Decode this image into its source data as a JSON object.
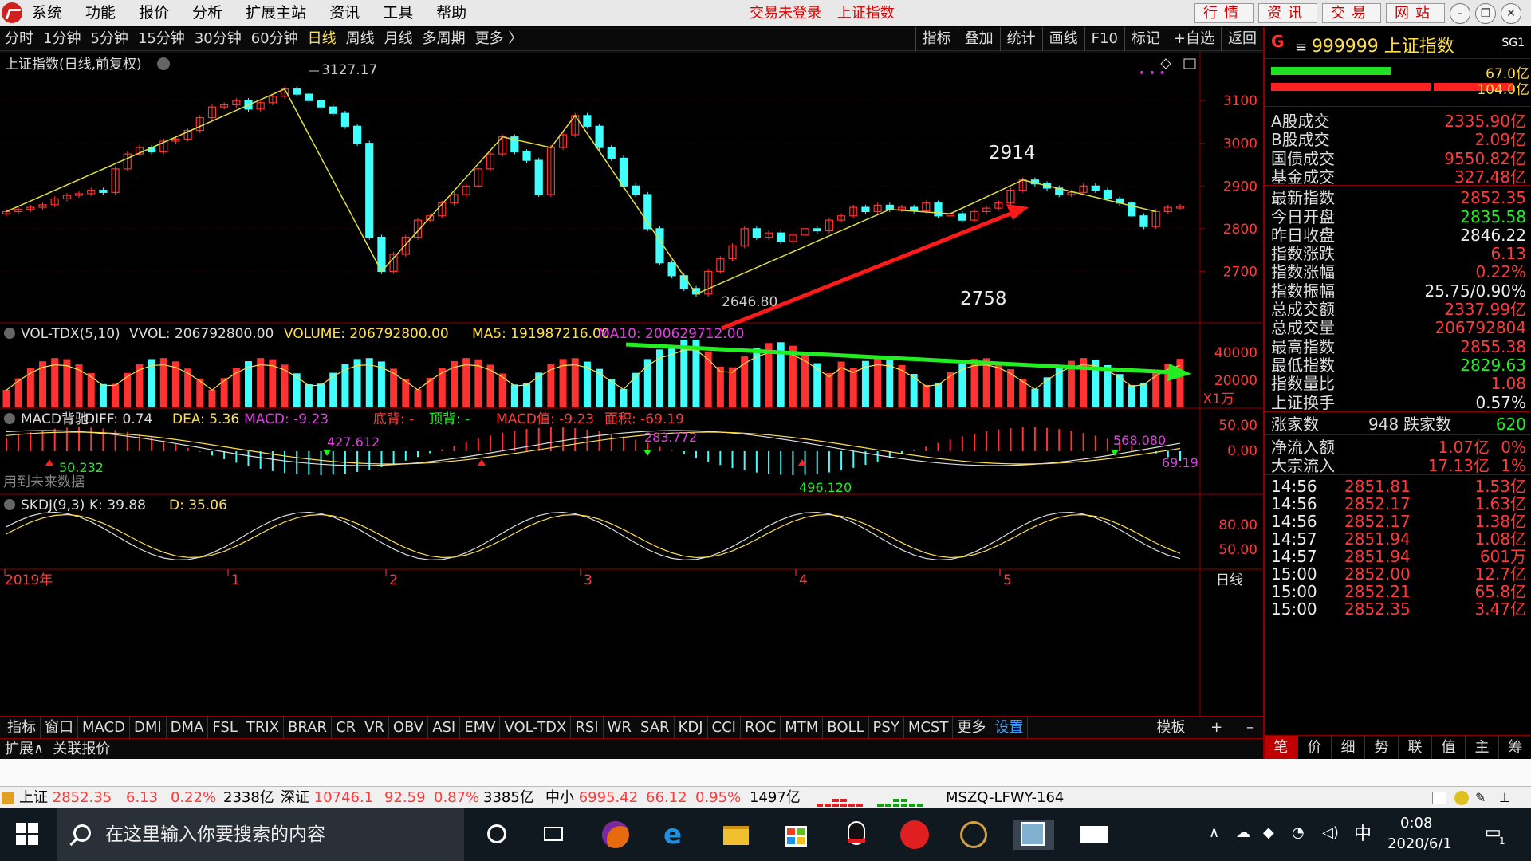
{
  "menubar": {
    "items": [
      "系统",
      "功能",
      "报价",
      "分析",
      "扩展主站",
      "资讯",
      "工具",
      "帮助"
    ],
    "status": "交易未登录",
    "title": "上证指数",
    "right_buttons": [
      "行情",
      "资讯",
      "交易",
      "网站"
    ]
  },
  "periodbar": {
    "items": [
      "分时",
      "1分钟",
      "5分钟",
      "15分钟",
      "30分钟",
      "60分钟",
      "日线",
      "周线",
      "月线",
      "多周期",
      "更多 〉"
    ],
    "active": "日线",
    "tools": [
      "指标",
      "叠加",
      "统计",
      "画线",
      "F10",
      "标记",
      "+自选",
      "返回"
    ]
  },
  "chart": {
    "title": "上证指数(日线,前复权)",
    "price_axis": [
      "3100",
      "3000",
      "2900",
      "2800",
      "2700"
    ],
    "annotations": {
      "high": "3127.17",
      "low": "2646.80",
      "label_2914": "2914",
      "label_2758": "2758"
    },
    "vol_header": {
      "name": "VOL-TDX(5,10)",
      "vvol": "VVOL: 206792800.00",
      "volume": "VOLUME: 206792800.00",
      "ma5": "MA5: 191987216.00",
      "ma10": "MA10: 200629712.00"
    },
    "vol_axis": [
      "40000",
      "20000",
      "X1万"
    ],
    "macd_header": {
      "name": "MACD背驰",
      "diff": "DIFF: 0.74",
      "dea": "DEA: 5.36",
      "macd": "MACD: -9.23",
      "bottom": "底背: -",
      "top": "顶背: -",
      "macd_val": "MACD值: -9.23",
      "area": "面积: -69.19"
    },
    "macd_axis": [
      "50.00",
      "0.00"
    ],
    "macd_labels": [
      "50.232",
      "427.612",
      "283.772",
      "496.120",
      "568.080",
      "69.19"
    ],
    "macd_note": "用到未来数据",
    "skdj_header": {
      "name": "SKDJ(9,3)",
      "k": "K: 39.88",
      "d": "D: 35.06"
    },
    "skdj_axis": [
      "80.00",
      "50.00"
    ],
    "time_axis": [
      "2019年",
      "1",
      "2",
      "3",
      "4",
      "5"
    ],
    "period_label": "日线"
  },
  "chart_data": {
    "type": "candlestick",
    "title": "上证指数(日线,前复权)",
    "series": [
      {
        "name": "price",
        "values": [
          2840,
          2845,
          2850,
          2856,
          2870,
          2878,
          2882,
          2890,
          2885,
          2940,
          2975,
          2990,
          2980,
          3005,
          3010,
          3030,
          3060,
          3085,
          3090,
          3100,
          3080,
          3095,
          3110,
          3127,
          3115,
          3100,
          3085,
          3070,
          3040,
          3000,
          2780,
          2700,
          2740,
          2780,
          2820,
          2830,
          2860,
          2880,
          2900,
          2940,
          2975,
          3015,
          2980,
          2960,
          2880,
          2990,
          3020,
          3065,
          3040,
          2990,
          2965,
          2900,
          2880,
          2800,
          2720,
          2690,
          2660,
          2647,
          2700,
          2730,
          2760,
          2800,
          2780,
          2790,
          2770,
          2785,
          2800,
          2795,
          2820,
          2830,
          2850,
          2840,
          2855,
          2845,
          2850,
          2842,
          2860,
          2830,
          2835,
          2820,
          2840,
          2848,
          2860,
          2890,
          2914,
          2905,
          2895,
          2880,
          2885,
          2900,
          2890,
          2870,
          2860,
          2830,
          2805,
          2840,
          2850,
          2852
        ]
      }
    ],
    "annotations": [
      "3127.17",
      "2646.80",
      "2914",
      "2758"
    ],
    "ylim": [
      2600,
      3160
    ]
  },
  "rpanel": {
    "code": "999999",
    "name": "上证指数",
    "badge": "SG1",
    "g": "G",
    "bar_vals": [
      "67.0亿",
      "104.0亿"
    ],
    "rows": [
      {
        "label": "A股成交",
        "value": "2335.90亿",
        "color": "red"
      },
      {
        "label": "B股成交",
        "value": "2.09亿",
        "color": "red"
      },
      {
        "label": "国债成交",
        "value": "9550.82亿",
        "color": "red"
      },
      {
        "label": "基金成交",
        "value": "327.48亿",
        "color": "red"
      },
      {
        "label": "最新指数",
        "value": "2852.35",
        "color": "red"
      },
      {
        "label": "今日开盘",
        "value": "2835.58",
        "color": "green"
      },
      {
        "label": "昨日收盘",
        "value": "2846.22",
        "color": "white"
      },
      {
        "label": "指数涨跌",
        "value": "6.13",
        "color": "red"
      },
      {
        "label": "指数涨幅",
        "value": "0.22%",
        "color": "red"
      },
      {
        "label": "指数振幅",
        "value": "25.75/0.90%",
        "color": "white"
      },
      {
        "label": "总成交额",
        "value": "2337.99亿",
        "color": "red"
      },
      {
        "label": "总成交量",
        "value": "206792804",
        "color": "red"
      },
      {
        "label": "最高指数",
        "value": "2855.38",
        "color": "red"
      },
      {
        "label": "最低指数",
        "value": "2829.63",
        "color": "green"
      },
      {
        "label": "指数量比",
        "value": "1.08",
        "color": "red"
      },
      {
        "label": "上证换手",
        "value": "0.57%",
        "color": "white"
      }
    ],
    "updown": {
      "up_label": "涨家数",
      "up": "948",
      "down_label": "跌家数",
      "down": "620"
    },
    "flows": [
      {
        "label": "净流入额",
        "value": "1.07亿",
        "pct": "0%"
      },
      {
        "label": "大宗流入",
        "value": "17.13亿",
        "pct": "1%"
      }
    ],
    "ticks": [
      {
        "t": "14:56",
        "p": "2851.81",
        "v": "1.53亿"
      },
      {
        "t": "14:56",
        "p": "2852.17",
        "v": "1.63亿"
      },
      {
        "t": "14:56",
        "p": "2852.17",
        "v": "1.38亿"
      },
      {
        "t": "14:57",
        "p": "2851.94",
        "v": "1.08亿"
      },
      {
        "t": "14:57",
        "p": "2851.94",
        "v": "601万"
      },
      {
        "t": "15:00",
        "p": "2852.00",
        "v": "12.7亿"
      },
      {
        "t": "15:00",
        "p": "2852.21",
        "v": "65.8亿"
      },
      {
        "t": "15:00",
        "p": "2852.35",
        "v": "3.47亿"
      }
    ],
    "tabs": [
      "笔",
      "价",
      "细",
      "势",
      "联",
      "值",
      "主",
      "筹"
    ]
  },
  "indbar": {
    "items": [
      "指标",
      "窗口",
      "MACD",
      "DMI",
      "DMA",
      "FSL",
      "TRIX",
      "BRAR",
      "CR",
      "VR",
      "OBV",
      "ASI",
      "EMV",
      "VOL-TDX",
      "RSI",
      "WR",
      "SAR",
      "KDJ",
      "CCI",
      "ROC",
      "MTM",
      "BOLL",
      "PSY",
      "MCST",
      "更多",
      "设置"
    ],
    "template": "模板",
    "expand": "扩展∧",
    "related": "关联报价"
  },
  "statusbar": {
    "sh_name": "上证",
    "sh_price": "2852.35",
    "sh_chg": "6.13",
    "sh_pct": "0.22%",
    "sh_amt": "2338亿",
    "sz_name": "深证",
    "sz_price": "10746.1",
    "sz_chg": "92.59",
    "sz_pct": "0.87%",
    "sz_amt": "3385亿",
    "zx_name": "中小",
    "zx_price": "6995.42",
    "zx_chg": "66.12",
    "zx_pct": "0.95%",
    "zx_amt": "1497亿",
    "server": "MSZQ-LFWY-164"
  },
  "taskbar": {
    "search_placeholder": "在这里输入你要搜索的内容",
    "ime": "中",
    "time": "0:08",
    "date": "2020/6/1",
    "notif": "1"
  },
  "colors": {
    "up": "#ff3232",
    "down": "#40ffff",
    "accent": "#ffe04a",
    "frame": "#8a0000"
  }
}
